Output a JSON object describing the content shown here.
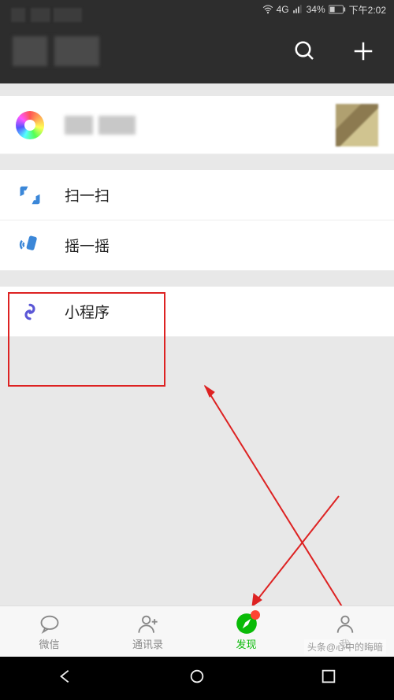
{
  "status": {
    "network": "4G",
    "battery": "34%",
    "time": "下午2:02"
  },
  "header": {},
  "rows": {
    "moments": {
      "label": ""
    },
    "scan": {
      "label": "扫一扫"
    },
    "shake": {
      "label": "摇一摇"
    },
    "mini": {
      "label": "小程序"
    }
  },
  "tabs": {
    "chat": {
      "label": "微信"
    },
    "contacts": {
      "label": "通讯录"
    },
    "discover": {
      "label": "发现"
    },
    "me": {
      "label": "我"
    }
  },
  "watermark": "头条@心中的晦暗"
}
